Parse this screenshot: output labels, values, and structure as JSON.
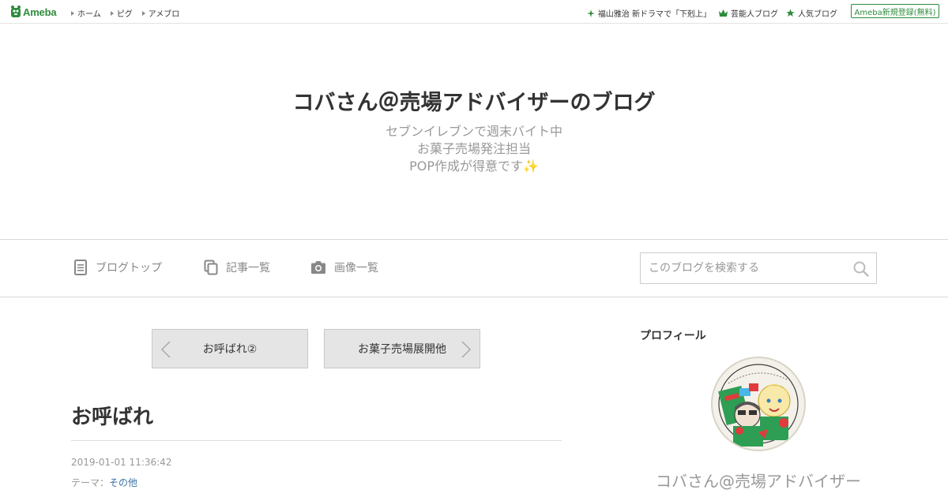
{
  "topbar": {
    "logo_text": "Ameba",
    "nav": [
      {
        "label": "ホーム"
      },
      {
        "label": "ピグ"
      },
      {
        "label": "アメブロ"
      }
    ],
    "right_links": [
      {
        "label": "福山雅治 新ドラマで「下剋上」",
        "icon": "sparkle-icon"
      },
      {
        "label": "芸能人ブログ",
        "icon": "crown-icon"
      },
      {
        "label": "人気ブログ",
        "icon": "star-icon"
      }
    ],
    "signup_label": "Ameba新規登録(無料)"
  },
  "blog": {
    "title": "コバさん＠売場アドバイザーのブログ",
    "description": [
      "セブンイレブンで週末バイト中",
      "お菓子売場発注担当",
      "POP作成が得意です✨"
    ]
  },
  "blog_nav": {
    "items": [
      {
        "label": "ブログトップ",
        "icon": "document-icon"
      },
      {
        "label": "記事一覧",
        "icon": "copy-icon"
      },
      {
        "label": "画像一覧",
        "icon": "camera-icon"
      }
    ],
    "search_placeholder": "このブログを検索する",
    "search_value": ""
  },
  "pager": {
    "prev_label": "お呼ばれ②",
    "next_label": "お菓子売場展開他"
  },
  "entry": {
    "title": "お呼ばれ",
    "date": "2019-01-01 11:36:42",
    "theme_prefix": "テーマ：",
    "theme": "その他"
  },
  "sidebar": {
    "profile_heading": "プロフィール",
    "profile_name": "コバさん@売場アドバイザー"
  },
  "colors": {
    "brand_green": "#2d8c3c",
    "link_blue": "#3b73a5",
    "muted_text": "#999999"
  }
}
